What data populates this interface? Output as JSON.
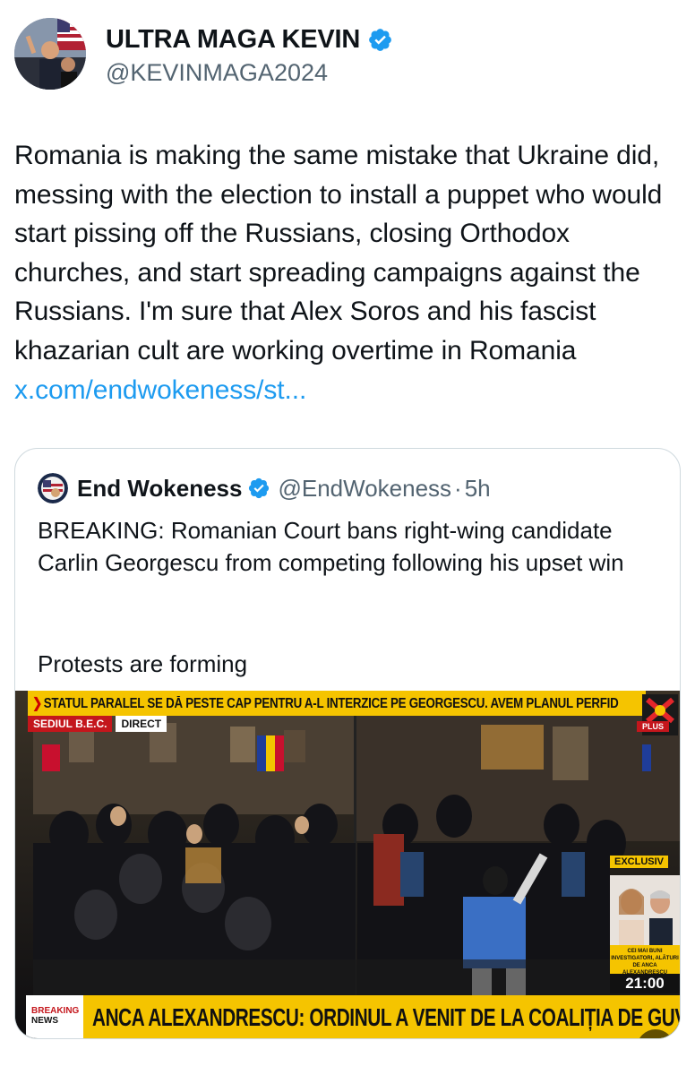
{
  "tweet": {
    "display_name": "ULTRA MAGA KEVIN",
    "handle": "@KEVINMAGA2024",
    "text": "Romania is making the same mistake that Ukraine did, messing with the election to install a puppet who would start pissing off the Russians, closing Orthodox churches, and start spreading campaigns against the Russians. I'm sure that Alex Soros and his fascist khazarian cult are working overtime in Romania ",
    "link_text": "x.com/endwokeness/st..."
  },
  "quote": {
    "display_name": "End Wokeness",
    "handle": "@EndWokeness",
    "separator": "·",
    "time": "5h",
    "text": "BREAKING: Romanian Court bans right-wing candidate Carlin Georgescu from competing following his upset win",
    "text2": "Protests are forming",
    "media": {
      "ticker_top": "STATUL PARALEL SE DĂ PESTE CAP PENTRU A-L INTERZICE PE GEORGESCU. AVEM PLANUL PERFID",
      "tag_location": "SEDIUL B.E.C.",
      "tag_live": "DIRECT",
      "channel_badge": "PLUS",
      "exclusive_label": "EXCLUSIV",
      "guest_caption": "CEI MAI BUNI INVESTIGATORI, ALĂTURI DE ANCA ALEXANDRESCU",
      "clock": "21:00",
      "breaking_1": "BREAKING",
      "breaking_2": "NEWS",
      "ticker_bottom": "ANCA ALEXANDRESCU: ORDINUL A VENIT DE LA COALIȚIA DE GUVERNARE"
    }
  },
  "colors": {
    "link": "#1d9bf0",
    "verified": "#1d9bf0",
    "ticker": "#f5c400",
    "news_red": "#c4161c"
  },
  "icons": {
    "verified": "verified-badge-icon",
    "mute": "volume-muted-icon"
  }
}
